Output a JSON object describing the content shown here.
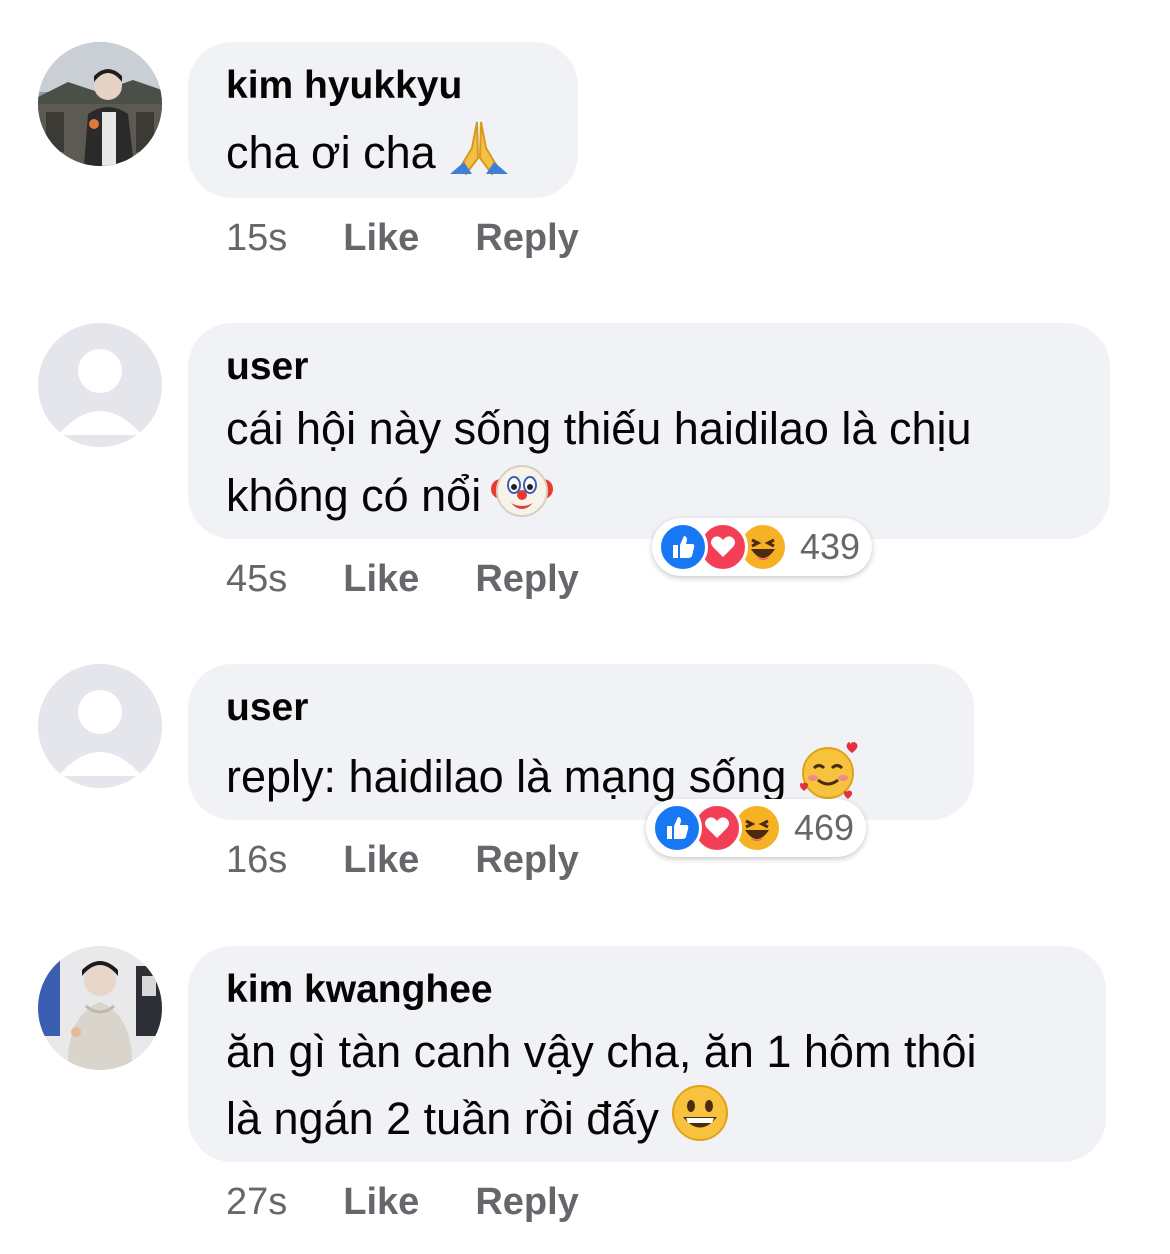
{
  "comments": [
    {
      "author": "kim hyukkyu",
      "text": "cha ơi cha",
      "emoji": "folded-hands",
      "time": "15s",
      "like_label": "Like",
      "reply_label": "Reply",
      "avatar": "photo"
    },
    {
      "author": "user",
      "text_line1": "cái hội này sống thiếu haidilao là chịu",
      "text_line2": "không có nổi",
      "emoji": "clown-face",
      "time": "45s",
      "like_label": "Like",
      "reply_label": "Reply",
      "avatar": "default",
      "reactions": [
        "like",
        "love",
        "haha"
      ],
      "reaction_count": "439"
    },
    {
      "author": "user",
      "text": "reply: haidilao là mạng sống",
      "emoji": "smiling-face-with-hearts",
      "time": "16s",
      "like_label": "Like",
      "reply_label": "Reply",
      "avatar": "default",
      "reactions": [
        "like",
        "love",
        "haha"
      ],
      "reaction_count": "469"
    },
    {
      "author": "kim kwanghee",
      "text_line1": "ăn gì tàn canh vậy cha, ăn 1 hôm thôi",
      "text_line2": "là ngán 2 tuần rồi đấy",
      "emoji": "grinning-face",
      "time": "27s",
      "like_label": "Like",
      "reply_label": "Reply",
      "avatar": "photo"
    }
  ],
  "colors": {
    "bubble": "#f0f2f5",
    "meta_text": "#65676b",
    "like": "#1877f2",
    "love": "#f33e58",
    "haha": "#f7b125"
  }
}
